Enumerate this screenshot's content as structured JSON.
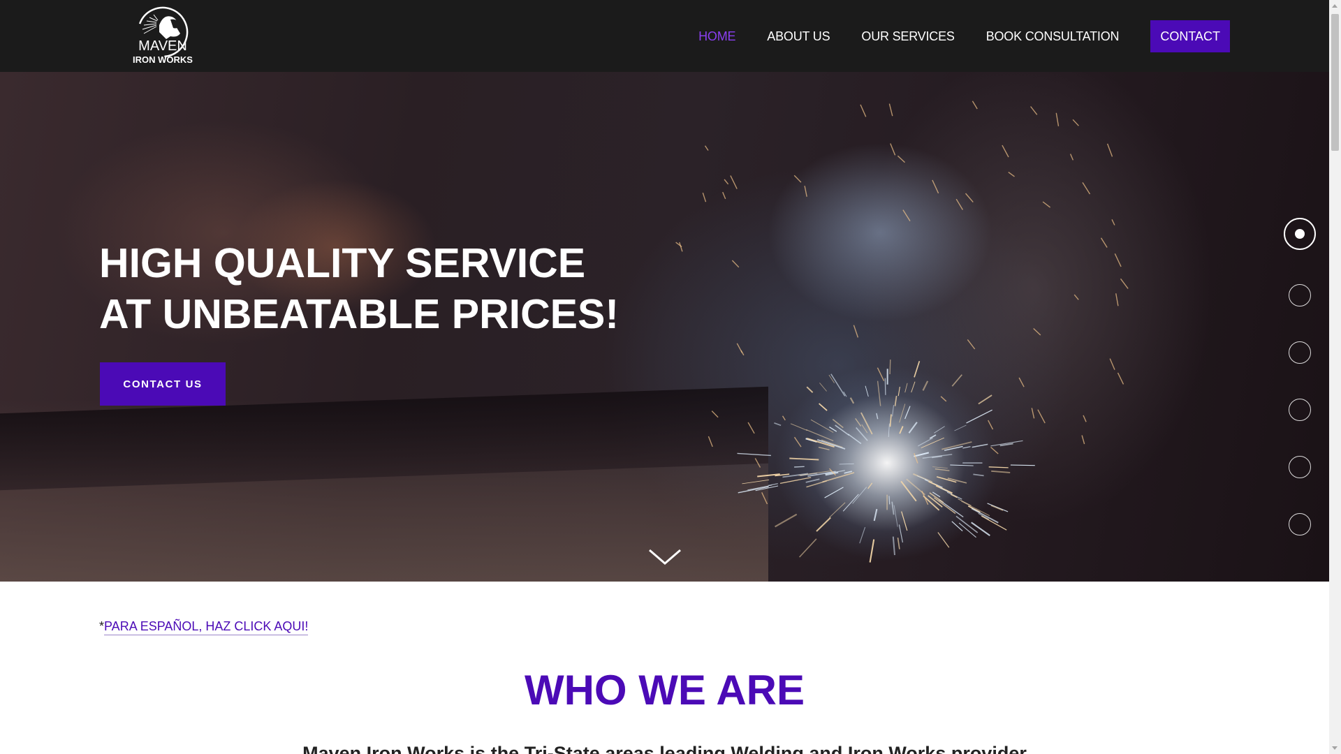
{
  "brand": {
    "logo_line1": "MAVEN",
    "logo_line2": "IRON WORKS"
  },
  "nav": {
    "items": [
      {
        "label": "HOME",
        "active": true
      },
      {
        "label": "ABOUT US",
        "active": false
      },
      {
        "label": "OUR SERVICES",
        "active": false
      },
      {
        "label": "BOOK CONSULTATION",
        "active": false
      }
    ],
    "contact_label": "CONTACT"
  },
  "hero": {
    "title_line1": "HIGH QUALITY SERVICE",
    "title_line2": "AT UNBEATABLE PRICES!",
    "cta_label": "CONTACT US",
    "slide_count": 6,
    "active_slide": 1
  },
  "content": {
    "espanol_prefix": "*",
    "espanol_link": "PARA ESPAÑOL, HAZ CLICK AQUI!",
    "section_title": "WHO WE ARE",
    "intro_text": "Maven Iron Works is the Tri-State areas leading Welding and Iron Works provider"
  },
  "colors": {
    "accent": "#4b0ab6",
    "nav_active": "#8a3ff0",
    "header_bg": "#1b1b1b"
  }
}
